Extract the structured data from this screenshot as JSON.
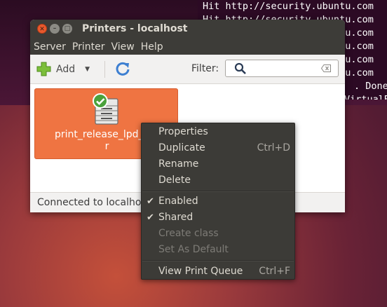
{
  "terminal": {
    "lines": [
      "Hit http://security.ubuntu.com",
      "Hit http://security.ubuntu.com",
      "Hit http://security.ubuntu.com",
      "Hit http://security.ubuntu.com",
      "Hit http://security.ubuntu.com",
      "Hit http://security.ubuntu.com",
      ". Done",
      "VirtualB"
    ]
  },
  "window": {
    "title": "Printers - localhost",
    "menu": [
      "Server",
      "Printer",
      "View",
      "Help"
    ],
    "toolbar": {
      "add_label": "Add",
      "filter_label": "Filter:",
      "filter_value": ""
    },
    "printer": {
      "name": "print_release_lpd_mu\nr",
      "status": "default-enabled"
    },
    "status_text": "Connected to localhos"
  },
  "context_menu": {
    "items": [
      {
        "label": "Properties",
        "accel": ""
      },
      {
        "label": "Duplicate",
        "accel": "Ctrl+D"
      },
      {
        "label": "Rename",
        "accel": ""
      },
      {
        "label": "Delete",
        "accel": ""
      },
      {
        "label": "Enabled",
        "accel": "",
        "checked": true
      },
      {
        "label": "Shared",
        "accel": "",
        "checked": true
      },
      {
        "label": "Create class",
        "accel": "",
        "disabled": true
      },
      {
        "label": "Set As Default",
        "accel": "",
        "disabled": true
      },
      {
        "label": "View Print Queue",
        "accel": "Ctrl+F"
      }
    ]
  },
  "colors": {
    "accent": "#ef7442",
    "titlebar": "#3d3c38",
    "menu_bg": "#3c3b37"
  }
}
